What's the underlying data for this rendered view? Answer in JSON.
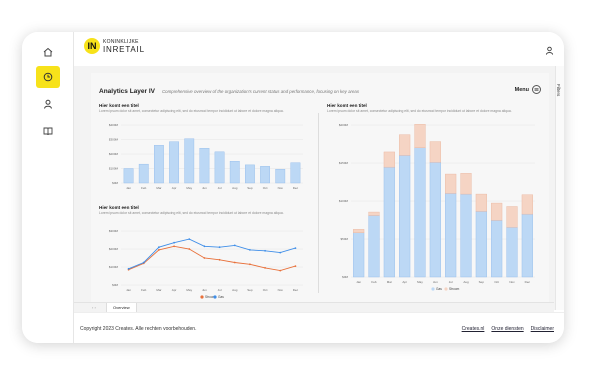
{
  "brand": {
    "mark": "IN",
    "line1": "KONINKLIJKE",
    "line2": "INRETAIL"
  },
  "rail": {
    "icons": [
      "home-icon",
      "clock-icon",
      "user-icon",
      "book-icon"
    ],
    "active": 1
  },
  "report": {
    "title": "Analytics Layer IV",
    "subtitle": "Comprehensive overview of the organization's current status and performance, focusing on key areas",
    "menu_label": "Menu"
  },
  "filters_label": "Filters",
  "charts": [
    {
      "title": "Hier komt een titel",
      "desc": "Lorem ipsum dolor sit amet, consectetur adipiscing elit, sed do eiusmod tempor incididunt ut labore et dolore magna aliqua."
    },
    {
      "title": "Hier komt een titel",
      "desc": "Lorem ipsum dolor sit amet, consectetur adipiscing elit, sed do eiusmod tempor incididunt ut labore et dolore magna aliqua."
    },
    {
      "title": "Hier komt een titel",
      "desc": "Lorem ipsum dolor sit amet, consectetur adipiscing elit, sed do eiusmod tempor incididunt ut labore et dolore magna aliqua."
    }
  ],
  "chart_data": [
    {
      "type": "bar",
      "categories": [
        "Jan",
        "Feb",
        "Mar",
        "Apr",
        "May",
        "Jun",
        "Jul",
        "Aug",
        "Sep",
        "Oct",
        "Nov",
        "Dec"
      ],
      "values": [
        100,
        130,
        260,
        285,
        305,
        240,
        215,
        150,
        125,
        115,
        95,
        140
      ],
      "ytick_labels": [
        "$0M",
        "$100M",
        "$200M",
        "$300M",
        "$400M"
      ],
      "ylim": [
        0,
        400
      ],
      "color": "#bcd8f5"
    },
    {
      "type": "line",
      "categories": [
        "Jan",
        "Feb",
        "Mar",
        "Apr",
        "May",
        "Jun",
        "Jul",
        "Aug",
        "Sep",
        "Oct",
        "Nov",
        "Dec"
      ],
      "series": [
        {
          "name": "Stroom",
          "values": [
            85,
            120,
            195,
            215,
            200,
            150,
            140,
            125,
            115,
            95,
            80,
            105
          ],
          "color": "#e8703a"
        },
        {
          "name": "Gas",
          "values": [
            90,
            125,
            210,
            235,
            255,
            215,
            210,
            220,
            195,
            190,
            180,
            205
          ],
          "color": "#3f8ee8"
        }
      ],
      "ytick_labels": [
        "$0M",
        "$100M",
        "$200M",
        "$300M"
      ],
      "ylim": [
        0,
        300
      ]
    },
    {
      "type": "bar",
      "categories": [
        "Jan",
        "Feb",
        "Mar",
        "Apr",
        "May",
        "Jun",
        "Jul",
        "Aug",
        "Sep",
        "Oct",
        "Nov",
        "Dec"
      ],
      "series": [
        {
          "name": "Stroom",
          "values": [
            5,
            5,
            22,
            30,
            34,
            30,
            28,
            30,
            25,
            25,
            30,
            28
          ],
          "color": "#f5d4c4"
        },
        {
          "name": "Gas",
          "values": [
            64,
            89,
            159,
            176,
            187,
            166,
            121,
            120,
            95,
            82,
            72,
            91
          ],
          "color": "#bcd8f5"
        }
      ],
      "ytick_labels": [
        "$0M",
        "$50M",
        "$100M",
        "$150M",
        "$200M"
      ],
      "ylim": [
        0,
        220
      ]
    }
  ],
  "tab_label": "Overview",
  "footer": {
    "copyright": "Copyright 2023 Creates. Alle rechten voorbehouden.",
    "links": [
      "Creates.nl",
      "Onze diensten",
      "Disclaimer"
    ]
  }
}
